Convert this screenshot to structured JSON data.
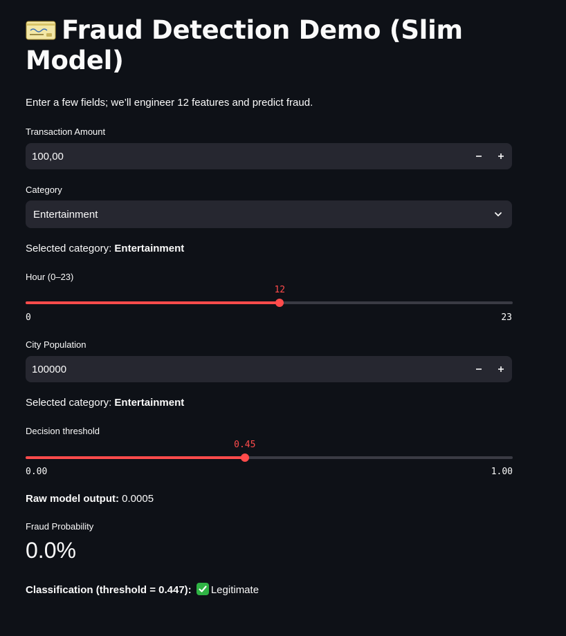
{
  "title": "Fraud Detection Demo (Slim Model)",
  "caption": "Enter a few fields; we’ll engineer 12 features and predict fraud.",
  "amount": {
    "label": "Transaction Amount",
    "value": "100,00",
    "minus": "−",
    "plus": "+"
  },
  "category": {
    "label": "Category",
    "value": "Entertainment"
  },
  "selected_category_1": {
    "prefix": "Selected category: ",
    "value": "Entertainment"
  },
  "hour": {
    "label": "Hour (0–23)",
    "value": "12",
    "min": "0",
    "max": "23",
    "level": 0.5217
  },
  "population": {
    "label": "City Population",
    "value": "100000",
    "minus": "−",
    "plus": "+"
  },
  "selected_category_2": {
    "prefix": "Selected category: ",
    "value": "Entertainment"
  },
  "threshold": {
    "label": "Decision threshold",
    "value": "0.45",
    "min": "0.00",
    "max": "1.00",
    "level": 0.45
  },
  "raw_output": {
    "prefix": "Raw model output:",
    "value": " 0.0005"
  },
  "fraud_probability": {
    "label": "Fraud Probability",
    "value": "0.0%"
  },
  "classification": {
    "prefix": "Classification (threshold = 0.447):",
    "value": "Legitimate"
  },
  "colors": {
    "accent": "#ff4b4b",
    "background": "#0e1117",
    "input_bg": "#262730",
    "check": "#2fb344"
  },
  "icons": {
    "title": "credit-card-icon",
    "stepper_minus": "minus-icon",
    "stepper_plus": "plus-icon",
    "select": "chevron-down-icon",
    "classification": "check-mark-button-icon"
  }
}
